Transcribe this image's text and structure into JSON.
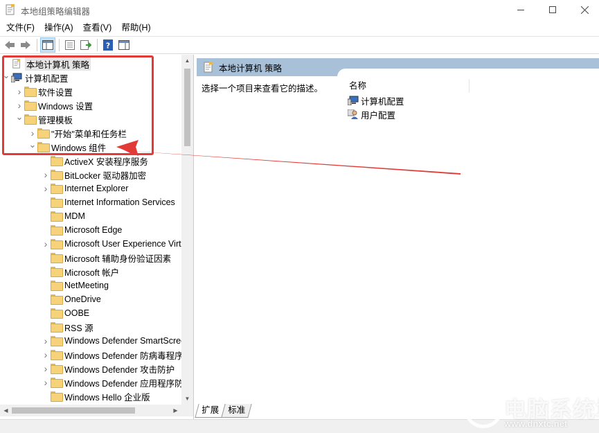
{
  "window": {
    "title": "本地组策略编辑器",
    "icon": "policy-editor-icon"
  },
  "menu": [
    "文件(F)",
    "操作(A)",
    "查看(V)",
    "帮助(H)"
  ],
  "toolbar": [
    "back-arrow-icon",
    "forward-arrow-icon",
    "show-hide-tree-icon",
    "properties-icon",
    "export-list-icon",
    "help-icon",
    "show-hide-pane-icon"
  ],
  "tree": {
    "items": [
      {
        "label": "本地计算机 策略",
        "icon": "policy-doc-icon",
        "chevron": "",
        "level": 0,
        "selected": true
      },
      {
        "label": "计算机配置",
        "icon": "computer-icon",
        "chevron": "⌄",
        "level": 0
      },
      {
        "label": "软件设置",
        "icon": "folder-icon",
        "chevron": "›",
        "level": 1
      },
      {
        "label": "Windows 设置",
        "icon": "folder-icon",
        "chevron": "›",
        "level": 1
      },
      {
        "label": "管理模板",
        "icon": "folder-icon",
        "chevron": "⌄",
        "level": 1
      },
      {
        "label": "\"开始\"菜单和任务栏",
        "icon": "folder-icon",
        "chevron": "›",
        "level": 2
      },
      {
        "label": "Windows 组件",
        "icon": "folder-icon",
        "chevron": "⌄",
        "level": 2
      },
      {
        "label": "ActiveX 安装程序服务",
        "icon": "folder-icon",
        "chevron": "",
        "level": 3
      },
      {
        "label": "BitLocker 驱动器加密",
        "icon": "folder-icon",
        "chevron": "›",
        "level": 3
      },
      {
        "label": "Internet Explorer",
        "icon": "folder-icon",
        "chevron": "›",
        "level": 3
      },
      {
        "label": "Internet Information Services",
        "icon": "folder-icon",
        "chevron": "",
        "level": 3
      },
      {
        "label": "MDM",
        "icon": "folder-icon",
        "chevron": "",
        "level": 3
      },
      {
        "label": "Microsoft Edge",
        "icon": "folder-icon",
        "chevron": "",
        "level": 3
      },
      {
        "label": "Microsoft User Experience Virtualization",
        "icon": "folder-icon",
        "chevron": "›",
        "level": 3
      },
      {
        "label": "Microsoft 辅助身份验证因素",
        "icon": "folder-icon",
        "chevron": "",
        "level": 3
      },
      {
        "label": "Microsoft 帐户",
        "icon": "folder-icon",
        "chevron": "",
        "level": 3
      },
      {
        "label": "NetMeeting",
        "icon": "folder-icon",
        "chevron": "",
        "level": 3
      },
      {
        "label": "OneDrive",
        "icon": "folder-icon",
        "chevron": "",
        "level": 3
      },
      {
        "label": "OOBE",
        "icon": "folder-icon",
        "chevron": "",
        "level": 3
      },
      {
        "label": "RSS 源",
        "icon": "folder-icon",
        "chevron": "",
        "level": 3
      },
      {
        "label": "Windows Defender SmartScreen",
        "icon": "folder-icon",
        "chevron": "›",
        "level": 3
      },
      {
        "label": "Windows Defender 防病毒程序",
        "icon": "folder-icon",
        "chevron": "›",
        "level": 3
      },
      {
        "label": "Windows Defender 攻击防护",
        "icon": "folder-icon",
        "chevron": "›",
        "level": 3
      },
      {
        "label": "Windows Defender 应用程序防护",
        "icon": "folder-icon",
        "chevron": "›",
        "level": 3
      },
      {
        "label": "Windows Hello 企业版",
        "icon": "folder-icon",
        "chevron": "",
        "level": 3
      }
    ]
  },
  "details": {
    "header": "本地计算机 策略",
    "description": "选择一个项目来查看它的描述。",
    "column_name": "名称",
    "items": [
      {
        "label": "计算机配置",
        "icon": "computer-icon"
      },
      {
        "label": "用户配置",
        "icon": "user-icon"
      }
    ]
  },
  "tabs": [
    "扩展",
    "标准"
  ],
  "annotation": {
    "color": "#e23a36"
  },
  "watermark": {
    "text": "电脑系统城",
    "sub": "www.dnxtc.net"
  }
}
